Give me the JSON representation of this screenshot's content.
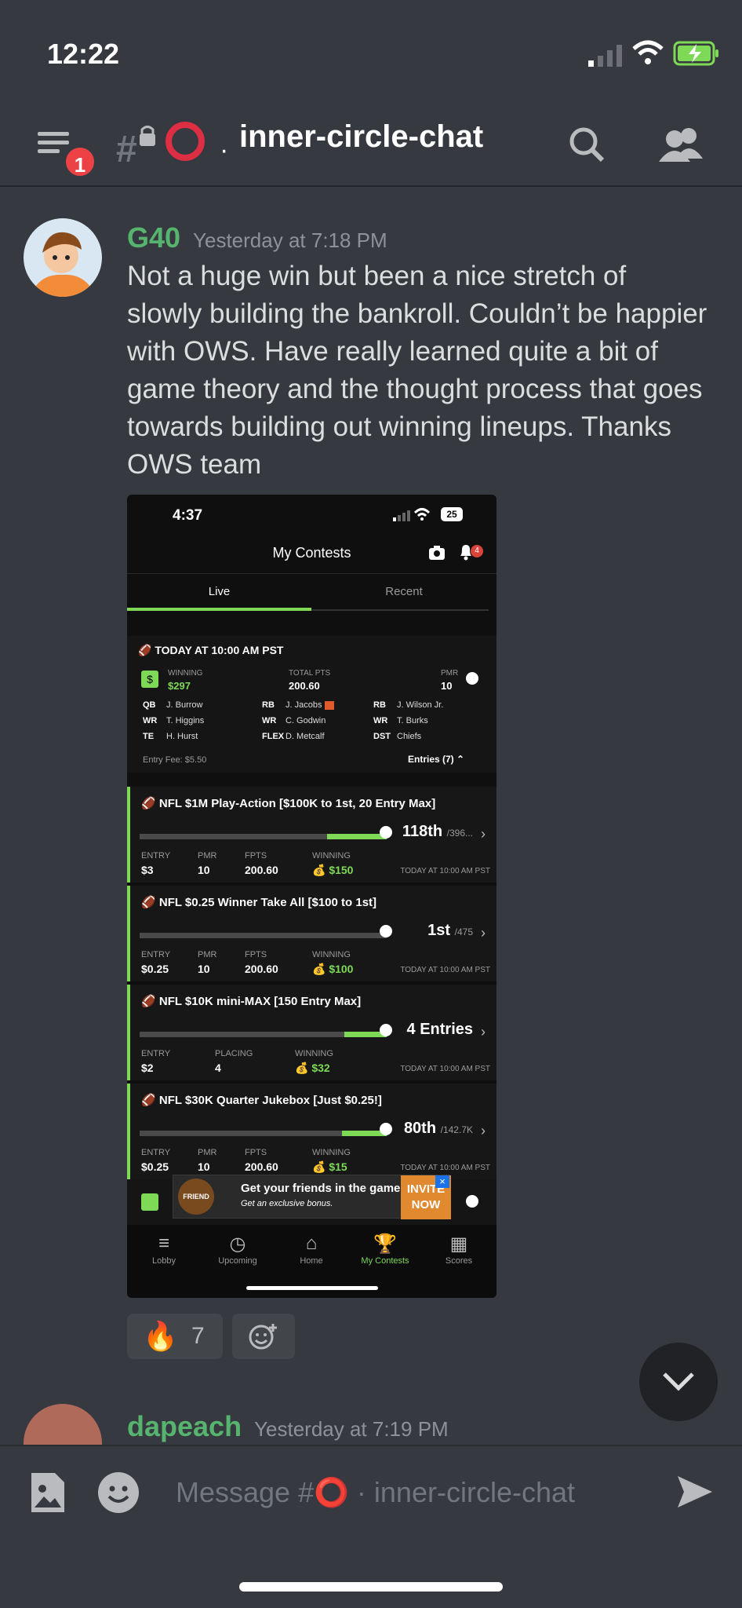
{
  "status_bar": {
    "time": "12:22"
  },
  "header": {
    "unread_badge": "1",
    "channel_title": "inner-circle-chat",
    "icons": [
      "menu-icon",
      "locked-channel-icon",
      "circle-icon",
      "search-icon",
      "members-icon"
    ]
  },
  "messages": [
    {
      "username": "G40",
      "timestamp": "Yesterday at 7:18 PM",
      "text": "Not a huge win but been a nice stretch of slowly building the bankroll. Couldn’t be happier with OWS. Have really learned quite a bit of game theory and the thought process that goes towards building out winning lineups. Thanks OWS team"
    },
    {
      "username": "dapeach",
      "timestamp": "Yesterday at 7:19 PM"
    }
  ],
  "attachment": {
    "time": "4:37",
    "battery": "25",
    "title": "My Contests",
    "notif_count": "4",
    "tabs": [
      "Live",
      "Recent"
    ],
    "slate": "TODAY AT 10:00 AM PST",
    "summary": {
      "winning_label": "WINNING",
      "winning": "$297",
      "total_label": "TOTAL PTS",
      "total": "200.60",
      "pmr_label": "PMR",
      "pmr": "10",
      "entry_fee": "Entry Fee: $5.50",
      "entries": "Entries (7)"
    },
    "roster": [
      [
        "QB",
        "J. Burrow"
      ],
      [
        "RB",
        "J. Jacobs"
      ],
      [
        "RB",
        "J. Wilson Jr."
      ],
      [
        "WR",
        "T. Higgins"
      ],
      [
        "WR",
        "C. Godwin"
      ],
      [
        "WR",
        "T. Burks"
      ],
      [
        "TE",
        "H. Hurst"
      ],
      [
        "FLEX",
        "D. Metcalf"
      ],
      [
        "DST",
        "Chiefs"
      ]
    ],
    "contests": [
      {
        "name": "NFL $1M Play-Action [$100K to 1st, 20 Entry Max]",
        "progress": 0.24,
        "place": "118th",
        "of": "/396...",
        "l1": "ENTRY",
        "v1": "$3",
        "l2": "PMR",
        "v2": "10",
        "l3": "FPTS",
        "v3": "200.60",
        "l4": "WINNING",
        "v4": "$150",
        "time": "TODAY AT 10:00 AM PST"
      },
      {
        "name": "NFL $0.25 Winner Take All [$100 to 1st]",
        "progress": 0.0,
        "place": "1st",
        "of": "/475",
        "l1": "ENTRY",
        "v1": "$0.25",
        "l2": "PMR",
        "v2": "10",
        "l3": "FPTS",
        "v3": "200.60",
        "l4": "WINNING",
        "v4": "$100",
        "time": "TODAY AT 10:00 AM PST"
      },
      {
        "name": "NFL $10K mini-MAX [150 Entry Max]",
        "progress": 0.17,
        "place": "4 Entries",
        "of": "",
        "l1": "ENTRY",
        "v1": "$2",
        "l2": "PLACING",
        "v2": "4",
        "l3": "",
        "v3": "",
        "l4": "WINNING",
        "v4": "$32",
        "time": "TODAY AT 10:00 AM PST"
      },
      {
        "name": "NFL $30K Quarter Jukebox [Just $0.25!]",
        "progress": 0.18,
        "place": "80th",
        "of": "/142.7K",
        "l1": "ENTRY",
        "v1": "$0.25",
        "l2": "PMR",
        "v2": "10",
        "l3": "FPTS",
        "v3": "200.60",
        "l4": "WINNING",
        "v4": "$15",
        "time": "TODAY AT 10:00 AM PST"
      }
    ],
    "ad": {
      "badge": "FRIEND",
      "headline": "Get your friends in the game.",
      "sub": "Get an exclusive bonus.",
      "cta": "INVITE NOW"
    },
    "nav": [
      "Lobby",
      "Upcoming",
      "Home",
      "My Contests",
      "Scores"
    ]
  },
  "reactions": [
    {
      "emoji": "🔥",
      "count": "7"
    }
  ],
  "composer": {
    "placeholder": "Message #⭕ · inner-circle-chat"
  },
  "colors": {
    "bg": "#36393f",
    "username": "#57b46e",
    "accent_green": "#7ed957",
    "badge_red": "#ed4245"
  }
}
